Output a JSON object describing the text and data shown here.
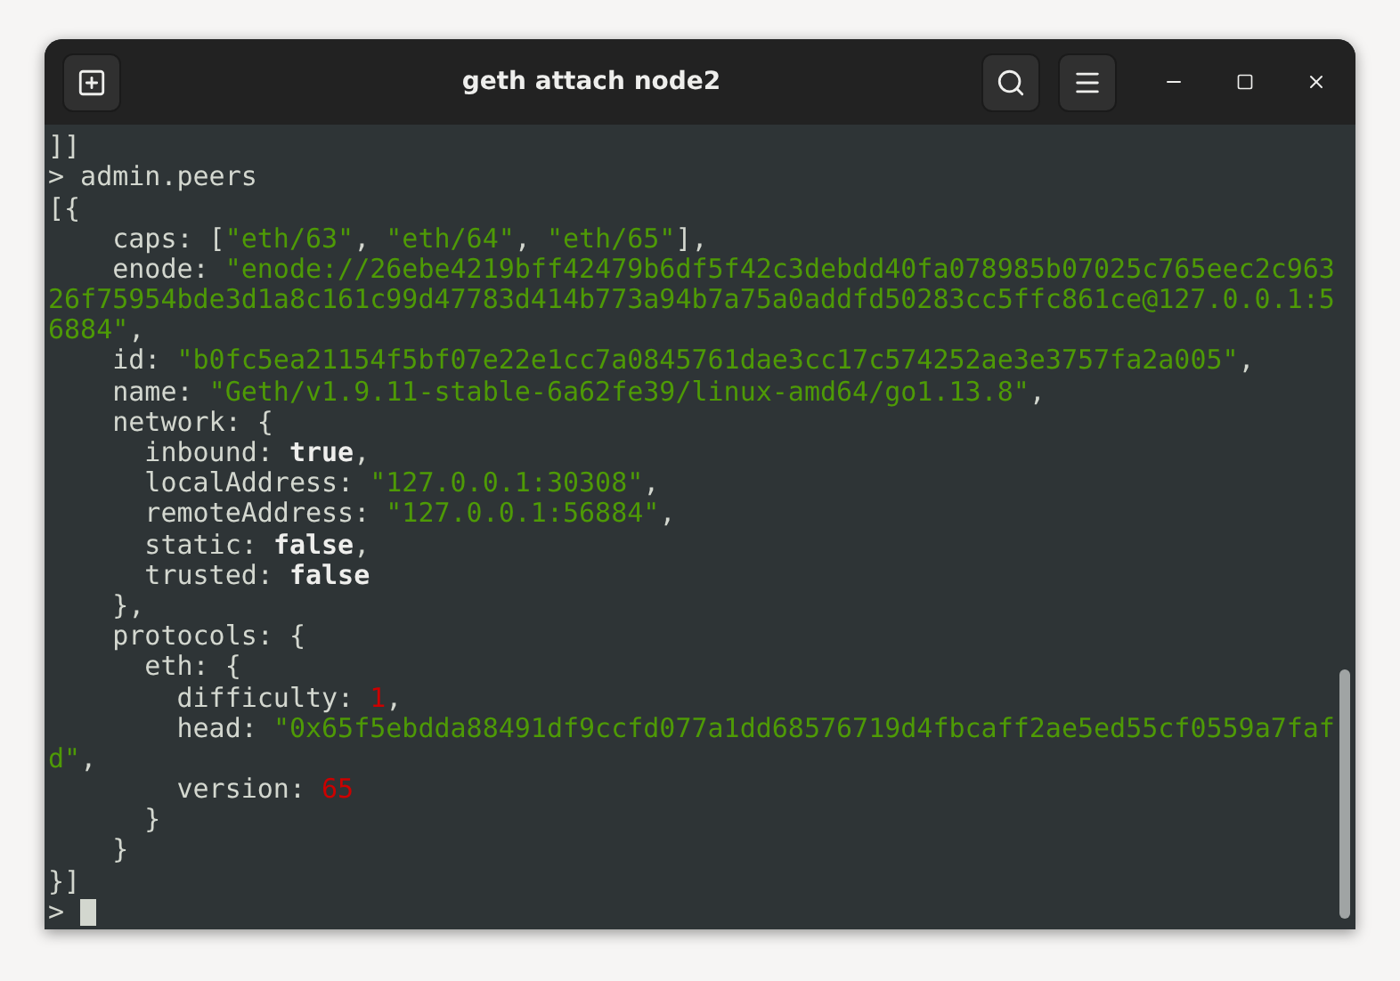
{
  "window": {
    "title": "geth attach node2"
  },
  "terminal": {
    "lines": [
      [
        {
          "kind": "plain",
          "text": "]]"
        }
      ],
      [
        {
          "kind": "plain",
          "text": "> admin.peers"
        }
      ],
      [
        {
          "kind": "plain",
          "text": "[{"
        }
      ],
      [
        {
          "kind": "plain",
          "text": "    caps: ["
        },
        {
          "kind": "string",
          "text": "\"eth/63\""
        },
        {
          "kind": "plain",
          "text": ", "
        },
        {
          "kind": "string",
          "text": "\"eth/64\""
        },
        {
          "kind": "plain",
          "text": ", "
        },
        {
          "kind": "string",
          "text": "\"eth/65\""
        },
        {
          "kind": "plain",
          "text": "],"
        }
      ],
      [
        {
          "kind": "plain",
          "text": "    enode: "
        },
        {
          "kind": "string",
          "text": "\"enode://26ebe4219bff42479b6df5f42c3debdd40fa078985b07025c765eec2c963"
        }
      ],
      [
        {
          "kind": "string",
          "text": "26f75954bde3d1a8c161c99d47783d414b773a94b7a75a0addfd50283cc5ffc861ce@127.0.0.1:5"
        }
      ],
      [
        {
          "kind": "string",
          "text": "6884\""
        },
        {
          "kind": "plain",
          "text": ","
        }
      ],
      [
        {
          "kind": "plain",
          "text": "    id: "
        },
        {
          "kind": "string",
          "text": "\"b0fc5ea21154f5bf07e22e1cc7a0845761dae3cc17c574252ae3e3757fa2a005\""
        },
        {
          "kind": "plain",
          "text": ","
        }
      ],
      [
        {
          "kind": "plain",
          "text": "    name: "
        },
        {
          "kind": "string",
          "text": "\"Geth/v1.9.11-stable-6a62fe39/linux-amd64/go1.13.8\""
        },
        {
          "kind": "plain",
          "text": ","
        }
      ],
      [
        {
          "kind": "plain",
          "text": "    network: {"
        }
      ],
      [
        {
          "kind": "plain",
          "text": "      inbound: "
        },
        {
          "kind": "bold",
          "text": "true"
        },
        {
          "kind": "plain",
          "text": ","
        }
      ],
      [
        {
          "kind": "plain",
          "text": "      localAddress: "
        },
        {
          "kind": "string",
          "text": "\"127.0.0.1:30308\""
        },
        {
          "kind": "plain",
          "text": ","
        }
      ],
      [
        {
          "kind": "plain",
          "text": "      remoteAddress: "
        },
        {
          "kind": "string",
          "text": "\"127.0.0.1:56884\""
        },
        {
          "kind": "plain",
          "text": ","
        }
      ],
      [
        {
          "kind": "plain",
          "text": "      static: "
        },
        {
          "kind": "bold",
          "text": "false"
        },
        {
          "kind": "plain",
          "text": ","
        }
      ],
      [
        {
          "kind": "plain",
          "text": "      trusted: "
        },
        {
          "kind": "bold",
          "text": "false"
        }
      ],
      [
        {
          "kind": "plain",
          "text": "    },"
        }
      ],
      [
        {
          "kind": "plain",
          "text": "    protocols: {"
        }
      ],
      [
        {
          "kind": "plain",
          "text": "      eth: {"
        }
      ],
      [
        {
          "kind": "plain",
          "text": "        difficulty: "
        },
        {
          "kind": "number",
          "text": "1"
        },
        {
          "kind": "plain",
          "text": ","
        }
      ],
      [
        {
          "kind": "plain",
          "text": "        head: "
        },
        {
          "kind": "string",
          "text": "\"0x65f5ebdda88491df9ccfd077a1dd68576719d4fbcaff2ae5ed55cf0559a7faf"
        }
      ],
      [
        {
          "kind": "string",
          "text": "d\""
        },
        {
          "kind": "plain",
          "text": ","
        }
      ],
      [
        {
          "kind": "plain",
          "text": "        version: "
        },
        {
          "kind": "number",
          "text": "65"
        }
      ],
      [
        {
          "kind": "plain",
          "text": "      }"
        }
      ],
      [
        {
          "kind": "plain",
          "text": "    }"
        }
      ],
      [
        {
          "kind": "plain",
          "text": "}]"
        }
      ],
      [
        {
          "kind": "plain",
          "text": "> "
        }
      ]
    ]
  }
}
